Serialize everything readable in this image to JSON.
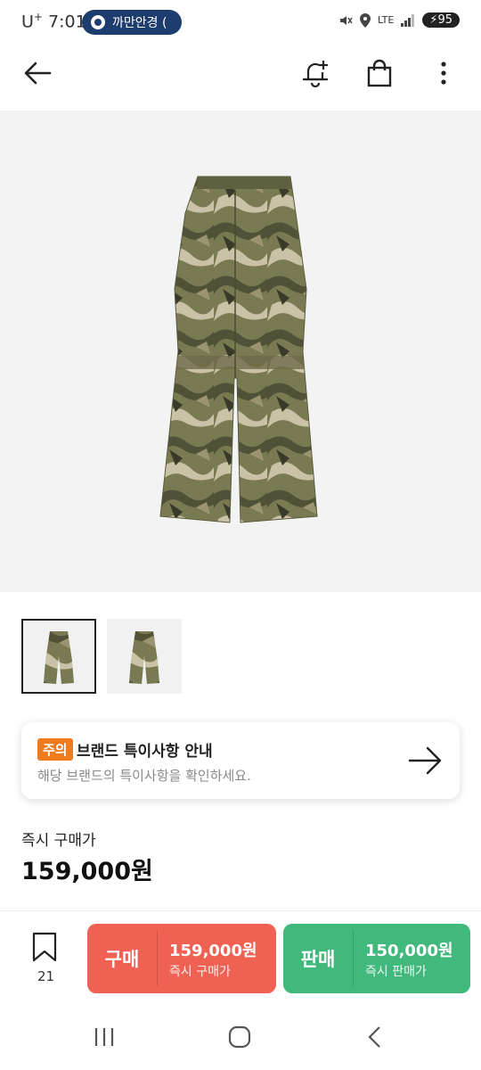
{
  "status_bar": {
    "carrier": "U",
    "carrier_sup": "+",
    "time": "7:01",
    "pill_text": "까만안경 (",
    "network": "LTE",
    "battery": "95"
  },
  "notice": {
    "badge": "주의",
    "title": "브랜드 특이사항 안내",
    "description": "해당 브랜드의 특이사항을 확인하세요."
  },
  "price": {
    "label": "즉시 구매가",
    "value": "159,000원"
  },
  "bottom_bar": {
    "bookmark_count": "21",
    "buy": {
      "tag": "구매",
      "amount": "159,000원",
      "sub": "즉시 구매가",
      "color": "#ef6253"
    },
    "sell": {
      "tag": "판매",
      "amount": "150,000원",
      "sub": "즉시 판매가",
      "color": "#41b97c"
    }
  },
  "icons": {
    "back": "back-arrow-icon",
    "alert": "bell-plus-icon",
    "bag": "shopping-bag-icon",
    "more": "more-vertical-icon",
    "bookmark": "bookmark-icon",
    "notice_arrow": "arrow-right-icon"
  }
}
